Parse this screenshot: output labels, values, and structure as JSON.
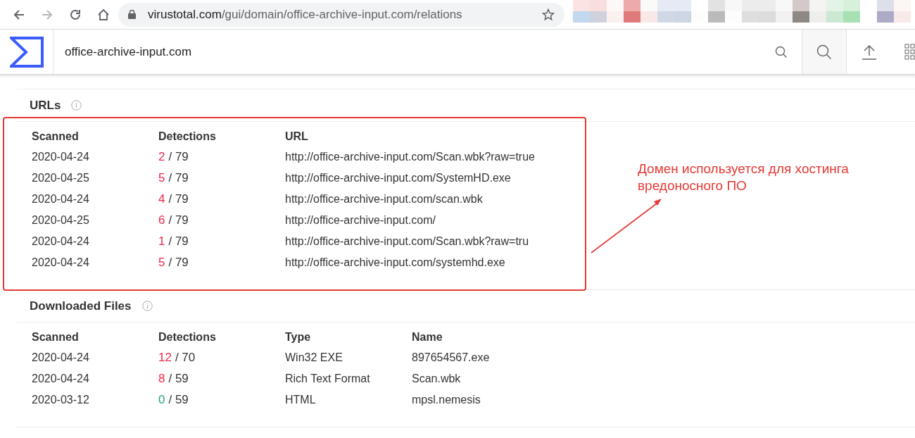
{
  "browser": {
    "url_host": "virustotal.com",
    "url_path": "/gui/domain/office-archive-input.com/relations"
  },
  "header": {
    "search_value": "office-archive-input.com"
  },
  "sections": [
    {
      "title": "URLs",
      "highlighted": true,
      "columns": [
        "Scanned",
        "Detections",
        "URL"
      ],
      "rows": [
        {
          "scanned": "2020-04-24",
          "positives": "2",
          "total": "/ 79",
          "flagged": true,
          "cells": [
            "http://office-archive-input.com/Scan.wbk?raw=true"
          ]
        },
        {
          "scanned": "2020-04-25",
          "positives": "5",
          "total": "/ 79",
          "flagged": true,
          "cells": [
            "http://office-archive-input.com/SystemHD.exe"
          ]
        },
        {
          "scanned": "2020-04-24",
          "positives": "4",
          "total": "/ 79",
          "flagged": true,
          "cells": [
            "http://office-archive-input.com/scan.wbk"
          ]
        },
        {
          "scanned": "2020-04-25",
          "positives": "6",
          "total": "/ 79",
          "flagged": true,
          "cells": [
            "http://office-archive-input.com/"
          ]
        },
        {
          "scanned": "2020-04-24",
          "positives": "1",
          "total": "/ 79",
          "flagged": true,
          "cells": [
            "http://office-archive-input.com/Scan.wbk?raw=tru"
          ]
        },
        {
          "scanned": "2020-04-24",
          "positives": "5",
          "total": "/ 79",
          "flagged": true,
          "cells": [
            "http://office-archive-input.com/systemhd.exe"
          ]
        }
      ]
    },
    {
      "title": "Downloaded Files",
      "highlighted": false,
      "columns": [
        "Scanned",
        "Detections",
        "Type",
        "Name"
      ],
      "rows": [
        {
          "scanned": "2020-04-24",
          "positives": "12",
          "total": "/ 70",
          "flagged": true,
          "cells": [
            "Win32 EXE",
            "897654567.exe"
          ]
        },
        {
          "scanned": "2020-04-24",
          "positives": "8",
          "total": "/ 59",
          "flagged": true,
          "cells": [
            "Rich Text Format",
            "Scan.wbk"
          ]
        },
        {
          "scanned": "2020-03-12",
          "positives": "0",
          "total": "/ 59",
          "flagged": false,
          "cells": [
            "HTML",
            "mpsl.nemesis"
          ]
        }
      ]
    }
  ],
  "annotation": {
    "text": "Домен используется для хостинга вредоносного ПО"
  }
}
